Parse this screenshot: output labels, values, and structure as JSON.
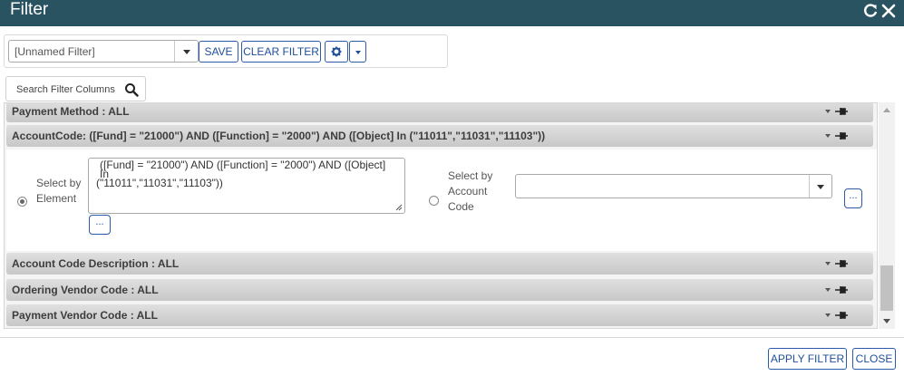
{
  "window": {
    "title": "Filter"
  },
  "toolbar": {
    "filter_select_value": "[Unnamed Filter]",
    "save_label": "SAVE",
    "clear_label": "CLEAR FILTER"
  },
  "search": {
    "placeholder": "Search Filter Columns"
  },
  "rows": [
    {
      "label": "Payment Method : ALL"
    },
    {
      "label": "AccountCode: ([Fund] = \"21000\") AND ([Function] = \"2000\") AND ([Object] In (\"11011\",\"11031\",\"11103\"))"
    },
    {
      "label": "Account Code Description : ALL"
    },
    {
      "label": "Ordering Vendor Code : ALL"
    },
    {
      "label": "Payment Vendor Code : ALL"
    }
  ],
  "expanded": {
    "select_by_element_label_1": "Select by",
    "select_by_element_label_2": "Element",
    "expression_line_1": "([Fund] = \"21000\") AND ([Function] = \"2000\") AND ([Object] In",
    "expression_line_2": "(\"11011\",\"11031\",\"11103\"))",
    "ellipsis_label": "...",
    "select_by_account_label_1": "Select by",
    "select_by_account_label_2": "Account",
    "select_by_account_label_3": "Code",
    "account_code_value": "",
    "account_ellipsis_label": "..."
  },
  "footer": {
    "apply_label": "APPLY FILTER",
    "close_label": "CLOSE"
  },
  "colors": {
    "titlebar": "#2a5361",
    "button_border": "#2a5aa8",
    "row_header": "#d0d0d0"
  },
  "icons": [
    "refresh-icon",
    "close-icon",
    "gear-icon",
    "search-icon",
    "pin-icon",
    "resize-grip-icon"
  ]
}
